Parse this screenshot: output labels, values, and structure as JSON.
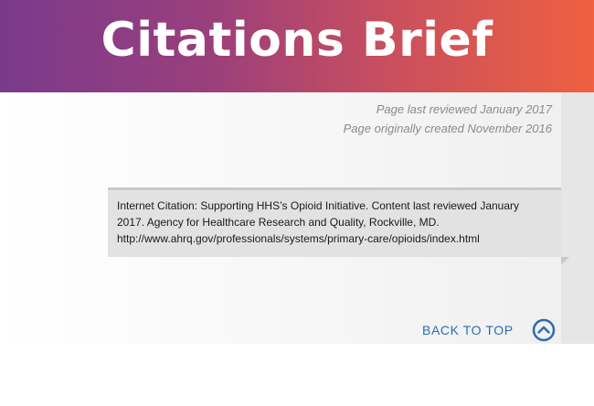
{
  "header": {
    "title": "Citations Brief"
  },
  "meta": {
    "last_reviewed": "Page last reviewed January 2017",
    "originally_created": "Page originally created November 2016"
  },
  "citation": {
    "line1": "Internet Citation: Supporting HHS’s Opioid Initiative. Content last reviewed January",
    "line2": "2017. Agency for Healthcare Research and Quality, Rockville, MD.",
    "line3": "http://www.ahrq.gov/professionals/systems/primary-care/opioids/index.html"
  },
  "back_to_top": {
    "label": "BACK TO TOP",
    "icon": "chevron-up-circle-icon"
  },
  "colors": {
    "banner_start": "#7a3a8c",
    "banner_end": "#ee6040",
    "link_blue": "#2b6cb0"
  }
}
